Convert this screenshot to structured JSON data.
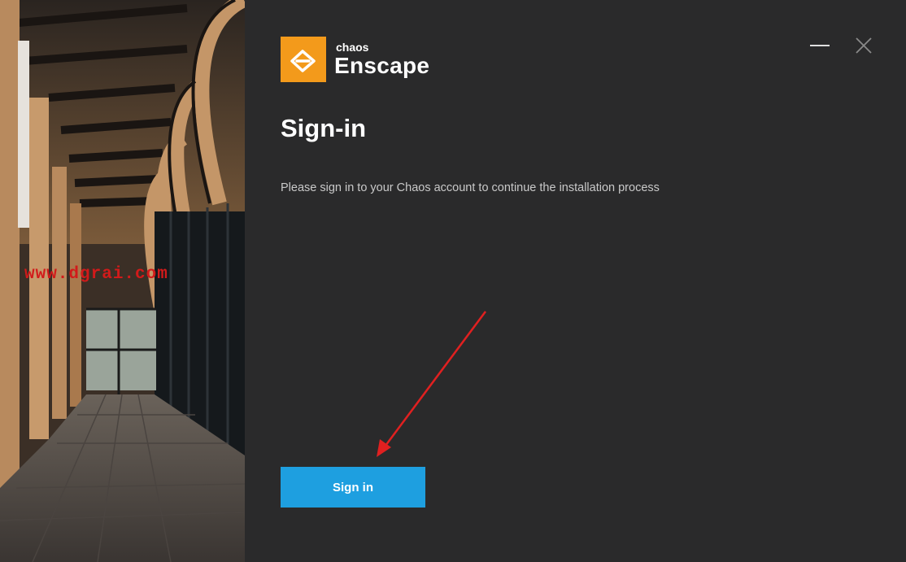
{
  "brand": {
    "company": "chaos",
    "product": "Enscape",
    "accent_color": "#f39a1b",
    "logo_icon": "enscape-logo-icon"
  },
  "watermark": "www.dgrai.com",
  "window_controls": {
    "minimize_icon": "minimize-icon",
    "close_icon": "close-icon"
  },
  "signin": {
    "title": "Sign-in",
    "message": "Please sign in to your Chaos account to continue the installation process",
    "button_label": "Sign in",
    "button_color": "#1e9fe0"
  },
  "annotation": {
    "arrow_color": "#e02020",
    "arrow_icon": "red-arrow-icon"
  }
}
